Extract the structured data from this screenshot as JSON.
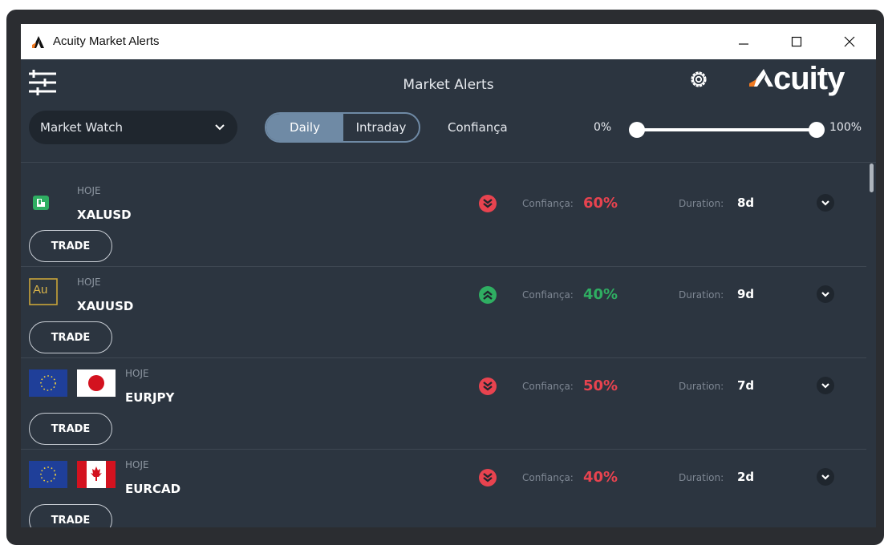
{
  "window": {
    "title": "Acuity Market Alerts",
    "controls": {
      "minimize": "—",
      "maximize": "☐",
      "close": "✕"
    }
  },
  "header": {
    "title": "Market Alerts",
    "brand": "cuity",
    "icons": {
      "menu": "sliders-icon",
      "settings": "gear-icon",
      "logo": "acuity-logo-icon"
    }
  },
  "controls": {
    "watchlist": {
      "selected": "Market Watch"
    },
    "period_tabs": [
      {
        "label": "Daily",
        "active": true
      },
      {
        "label": "Intraday",
        "active": false
      }
    ],
    "confidence_label": "Confiança",
    "range": {
      "min_label": "0%",
      "max_label": "100%",
      "low": 0,
      "high": 100
    }
  },
  "colors": {
    "background": "#2c3540",
    "header_bar": "#2c3540",
    "bearish": "#e8434f",
    "bullish": "#2fae62",
    "accent_tab": "#6f8aa5",
    "brand_orange": "#f07a22"
  },
  "alerts": [
    {
      "day": "HOJE",
      "symbol": "XALUSD",
      "direction": "down",
      "confidence_label": "Confiança:",
      "confidence": "60%",
      "duration_label": "Duration:",
      "duration": "8d",
      "trade_label": "TRADE",
      "icon": "aluminium-icon"
    },
    {
      "day": "HOJE",
      "symbol": "XAUUSD",
      "direction": "up",
      "confidence_label": "Confiança:",
      "confidence": "40%",
      "duration_label": "Duration:",
      "duration": "9d",
      "trade_label": "TRADE",
      "icon": "gold-icon",
      "icon_text": "Au"
    },
    {
      "day": "HOJE",
      "symbol": "EURJPY",
      "direction": "down",
      "confidence_label": "Confiança:",
      "confidence": "50%",
      "duration_label": "Duration:",
      "duration": "7d",
      "trade_label": "TRADE",
      "icon": "eu-jp-flags-icon"
    },
    {
      "day": "HOJE",
      "symbol": "EURCAD",
      "direction": "down",
      "confidence_label": "Confiança:",
      "confidence": "40%",
      "duration_label": "Duration:",
      "duration": "2d",
      "trade_label": "TRADE",
      "icon": "eu-ca-flags-icon"
    }
  ]
}
